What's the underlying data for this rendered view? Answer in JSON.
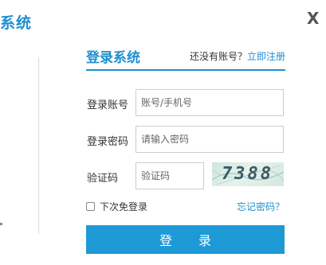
{
  "header": {
    "title_fragment": "系统",
    "close_symbol": "X"
  },
  "panel": {
    "title": "登录系统",
    "register_prompt": "还没有账号？",
    "register_link": "立即注册"
  },
  "form": {
    "account": {
      "label": "登录账号",
      "value": "",
      "placeholder": "账号/手机号"
    },
    "password": {
      "label": "登录密码",
      "value": "",
      "placeholder": "请输入密码"
    },
    "captcha": {
      "label": "验证码",
      "value": "",
      "placeholder": "验证码",
      "image_text": "7388"
    },
    "remember_label": "下次免登录",
    "forgot_link": "忘记密码？",
    "submit_label": "登 录"
  },
  "colors": {
    "accent": "#1f8fce",
    "button": "#1d9ad6",
    "button_text": "#ffffff"
  },
  "icons": {
    "close": "close-icon",
    "checkbox": "checkbox-icon"
  }
}
